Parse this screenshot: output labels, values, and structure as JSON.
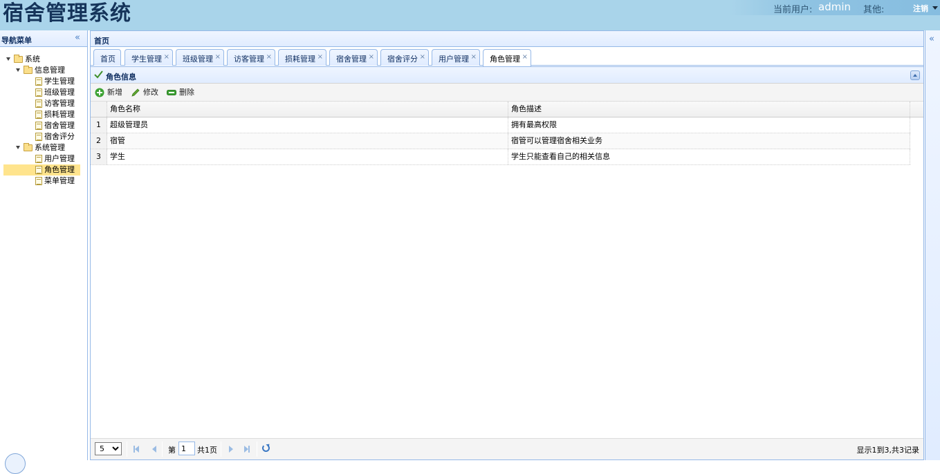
{
  "header": {
    "title": "宿舍管理系统",
    "current_user_label": "当前用户:",
    "current_user": "admin",
    "other_label": "其他:",
    "logout": "注销"
  },
  "west": {
    "title": "导航菜单",
    "collapse_glyph": "«",
    "tree": {
      "root": "系统",
      "info_group": "信息管理",
      "info_items": [
        "学生管理",
        "班级管理",
        "访客管理",
        "损耗管理",
        "宿舍管理",
        "宿舍评分"
      ],
      "sys_group": "系统管理",
      "sys_items": [
        "用户管理",
        "角色管理",
        "菜单管理"
      ],
      "selected": "角色管理"
    }
  },
  "center": {
    "title": "首页",
    "tabs": [
      {
        "label": "首页",
        "closable": false
      },
      {
        "label": "学生管理",
        "closable": true
      },
      {
        "label": "班级管理",
        "closable": true
      },
      {
        "label": "访客管理",
        "closable": true
      },
      {
        "label": "损耗管理",
        "closable": true
      },
      {
        "label": "宿舍管理",
        "closable": true
      },
      {
        "label": "宿舍评分",
        "closable": true
      },
      {
        "label": "用户管理",
        "closable": true
      },
      {
        "label": "角色管理",
        "closable": true,
        "active": true
      }
    ],
    "close_glyph": "×",
    "panel": {
      "title": "角色信息",
      "toolbar": {
        "add": "新增",
        "edit": "修改",
        "delete": "删除"
      },
      "grid": {
        "columns": [
          "角色名称",
          "角色描述"
        ],
        "rows": [
          {
            "num": "1",
            "name": "超级管理员",
            "desc": "拥有最高权限"
          },
          {
            "num": "2",
            "name": "宿管",
            "desc": "宿管可以管理宿舍相关业务"
          },
          {
            "num": "3",
            "name": "学生",
            "desc": "学生只能查看自己的相关信息"
          }
        ]
      },
      "pager": {
        "page_size": "5",
        "page_prefix": "第",
        "page_value": "1",
        "page_total": "共1页",
        "info": "显示1到3,共3记录"
      }
    }
  },
  "east": {
    "expand_glyph": "«"
  },
  "colors": {
    "header_bg": "#a9d4ea",
    "border": "#95b8e7",
    "selected": "#ffe48d",
    "title_text": "#15345a"
  },
  "icons": [
    "folder-icon",
    "file-icon",
    "check-icon",
    "add-icon",
    "edit-icon",
    "delete-icon",
    "refresh-icon",
    "first-page-icon",
    "prev-page-icon",
    "next-page-icon",
    "last-page-icon"
  ]
}
